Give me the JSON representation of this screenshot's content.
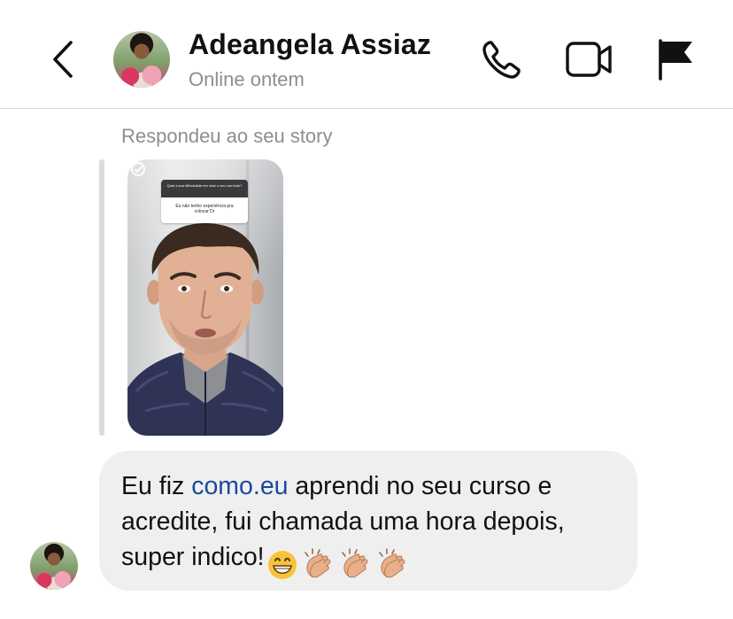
{
  "header": {
    "contact_name": "Adeangela Assiaz",
    "status": "Online ontem",
    "back_icon": "chevron-left-icon",
    "call_icon": "phone-icon",
    "video_icon": "video-camera-icon",
    "report_icon": "flag-icon"
  },
  "story_reply": {
    "caption": "Respondeu ao seu story",
    "question_text": "Qual a sua dificuldade em criar o seu currículo?",
    "answer_text": "Eu não tenho experiência pra colocar Dr"
  },
  "message": {
    "text_before_link": "Eu fiz ",
    "link_text": "como.eu",
    "text_after_link": " aprendi no seu curso e acredite, fui chamada uma hora depois, super indico!",
    "emojis": [
      "grinning-face-emoji",
      "clapping-hands-emoji",
      "clapping-hands-emoji",
      "clapping-hands-emoji"
    ]
  },
  "colors": {
    "link": "#1b4a9e",
    "bubble_background": "#efefef",
    "secondary_text": "#8e8e8e",
    "divider": "#dbdbdb"
  }
}
